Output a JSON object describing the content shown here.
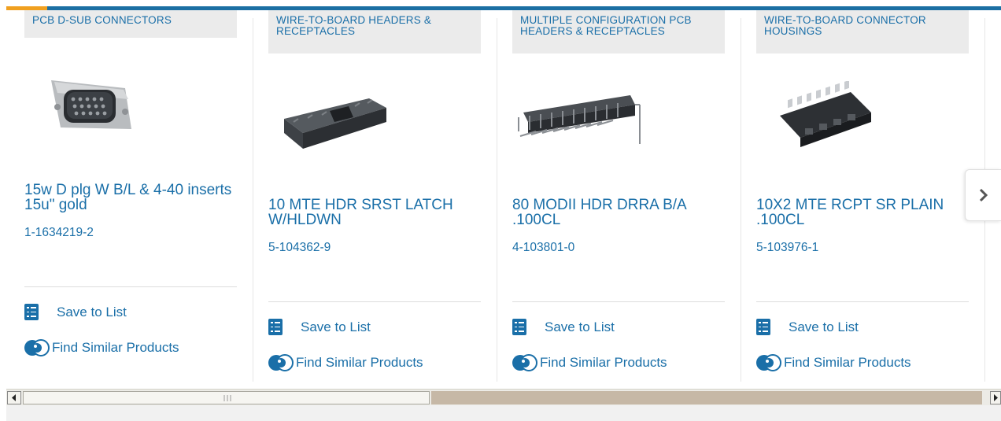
{
  "products": [
    {
      "category": "PCB D-SUB CONNECTORS",
      "title": "15w D plg W B/L & 4-40 inserts 15u\" gold",
      "part_number": "1-1634219-2",
      "image_icon": "d-sub-connector-image"
    },
    {
      "category": "WIRE-TO-BOARD HEADERS & RECEPTACLES",
      "title": "10 MTE HDR SRST LATCH W/HLDWN",
      "part_number": "5-104362-9",
      "image_icon": "wire-to-board-header-image"
    },
    {
      "category": "MULTIPLE CONFIGURATION PCB HEADERS & RECEPTACLES",
      "title": "80 MODII HDR DRRA B/A .100CL",
      "part_number": "4-103801-0",
      "image_icon": "pcb-header-image"
    },
    {
      "category": "WIRE-TO-BOARD CONNECTOR HOUSINGS",
      "title": "10X2 MTE RCPT SR PLAIN .100CL",
      "part_number": "5-103976-1",
      "image_icon": "connector-housing-image"
    }
  ],
  "actions": {
    "save_label": "Save to List",
    "similar_label": "Find Similar Products"
  },
  "colors": {
    "link": "#1a6fa8",
    "accent_bar": "#1c6fa3",
    "accent_orange": "#f0a020",
    "category_bg": "#ebebeb"
  }
}
